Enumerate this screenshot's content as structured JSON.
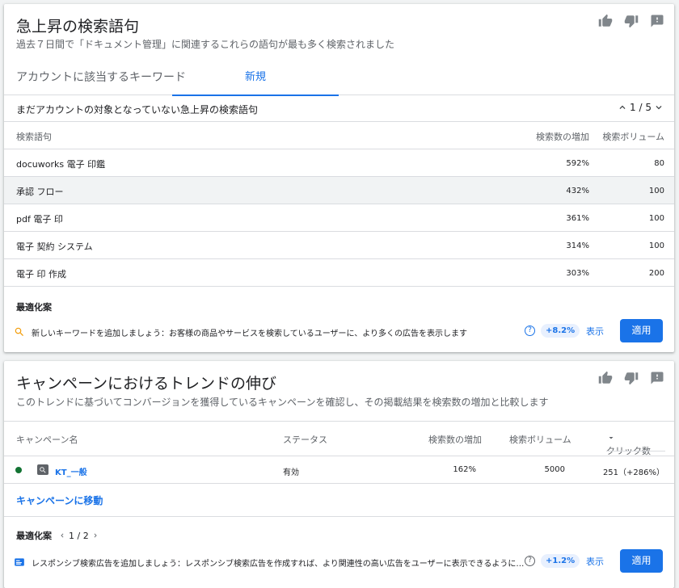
{
  "card1": {
    "title": "急上昇の検索語句",
    "subtitle": "過去７日間で「ドキュメント管理」に関連するこれらの語句が最も多く検索されました",
    "tabs": [
      "アカウントに該当するキーワード",
      "新規"
    ],
    "active_tab": 1,
    "section_label": "まだアカウントの対象となっていない急上昇の検索語句",
    "pager": "1 / 5",
    "columns": {
      "term": "検索語句",
      "growth": "検索数の増加",
      "volume": "検索ボリューム"
    },
    "rows": [
      {
        "term": "docuworks 電子 印鑑",
        "growth": "592%",
        "volume": "80"
      },
      {
        "term": "承認 フロー",
        "growth": "432%",
        "volume": "100"
      },
      {
        "term": "pdf 電子 印",
        "growth": "361%",
        "volume": "100"
      },
      {
        "term": "電子 契約 システム",
        "growth": "314%",
        "volume": "100"
      },
      {
        "term": "電子 印 作成",
        "growth": "303%",
        "volume": "200"
      }
    ],
    "optimization_title": "最適化案",
    "recommendation": {
      "text": "新しいキーワードを追加しましょう：お客様の商品やサービスを検索しているユーザーに、より多くの広告を表示します",
      "score": "+8.2%",
      "view": "表示",
      "apply": "適用"
    }
  },
  "card2": {
    "title": "キャンペーンにおけるトレンドの伸び",
    "subtitle": "このトレンドに基づいてコンバージョンを獲得しているキャンペーンを確認し、その掲載結果を検索数の増加と比較します",
    "columns": {
      "name": "キャンペーン名",
      "status": "ステータス",
      "growth": "検索数の増加",
      "volume": "検索ボリューム",
      "clicks": "クリック数"
    },
    "row": {
      "name": "KT_一般",
      "status": "有効",
      "growth": "162%",
      "volume": "5000",
      "clicks": "251（+286%）",
      "status_color": "#137333"
    },
    "goto_link": "キャンペーンに移動",
    "optimization_title": "最適化案",
    "opt_pager": "1 / 2",
    "recommendation": {
      "text": "レスポンシブ検索広告を追加しましょう：レスポンシブ検索広告を作成すれば、より関連性の高い広告をユーザーに表示できるように…",
      "score": "+1.2%",
      "view": "表示",
      "apply": "適用"
    }
  },
  "icons": [
    "thumb-up-icon",
    "thumb-down-icon",
    "feedback-icon",
    "search-icon",
    "chevron-up-icon",
    "chevron-down-icon",
    "sort-down-icon",
    "help-icon",
    "ad-icon"
  ],
  "colors": {
    "accent": "#1a73e8",
    "status_enabled": "#137333",
    "rec_icon": "#f29900"
  }
}
